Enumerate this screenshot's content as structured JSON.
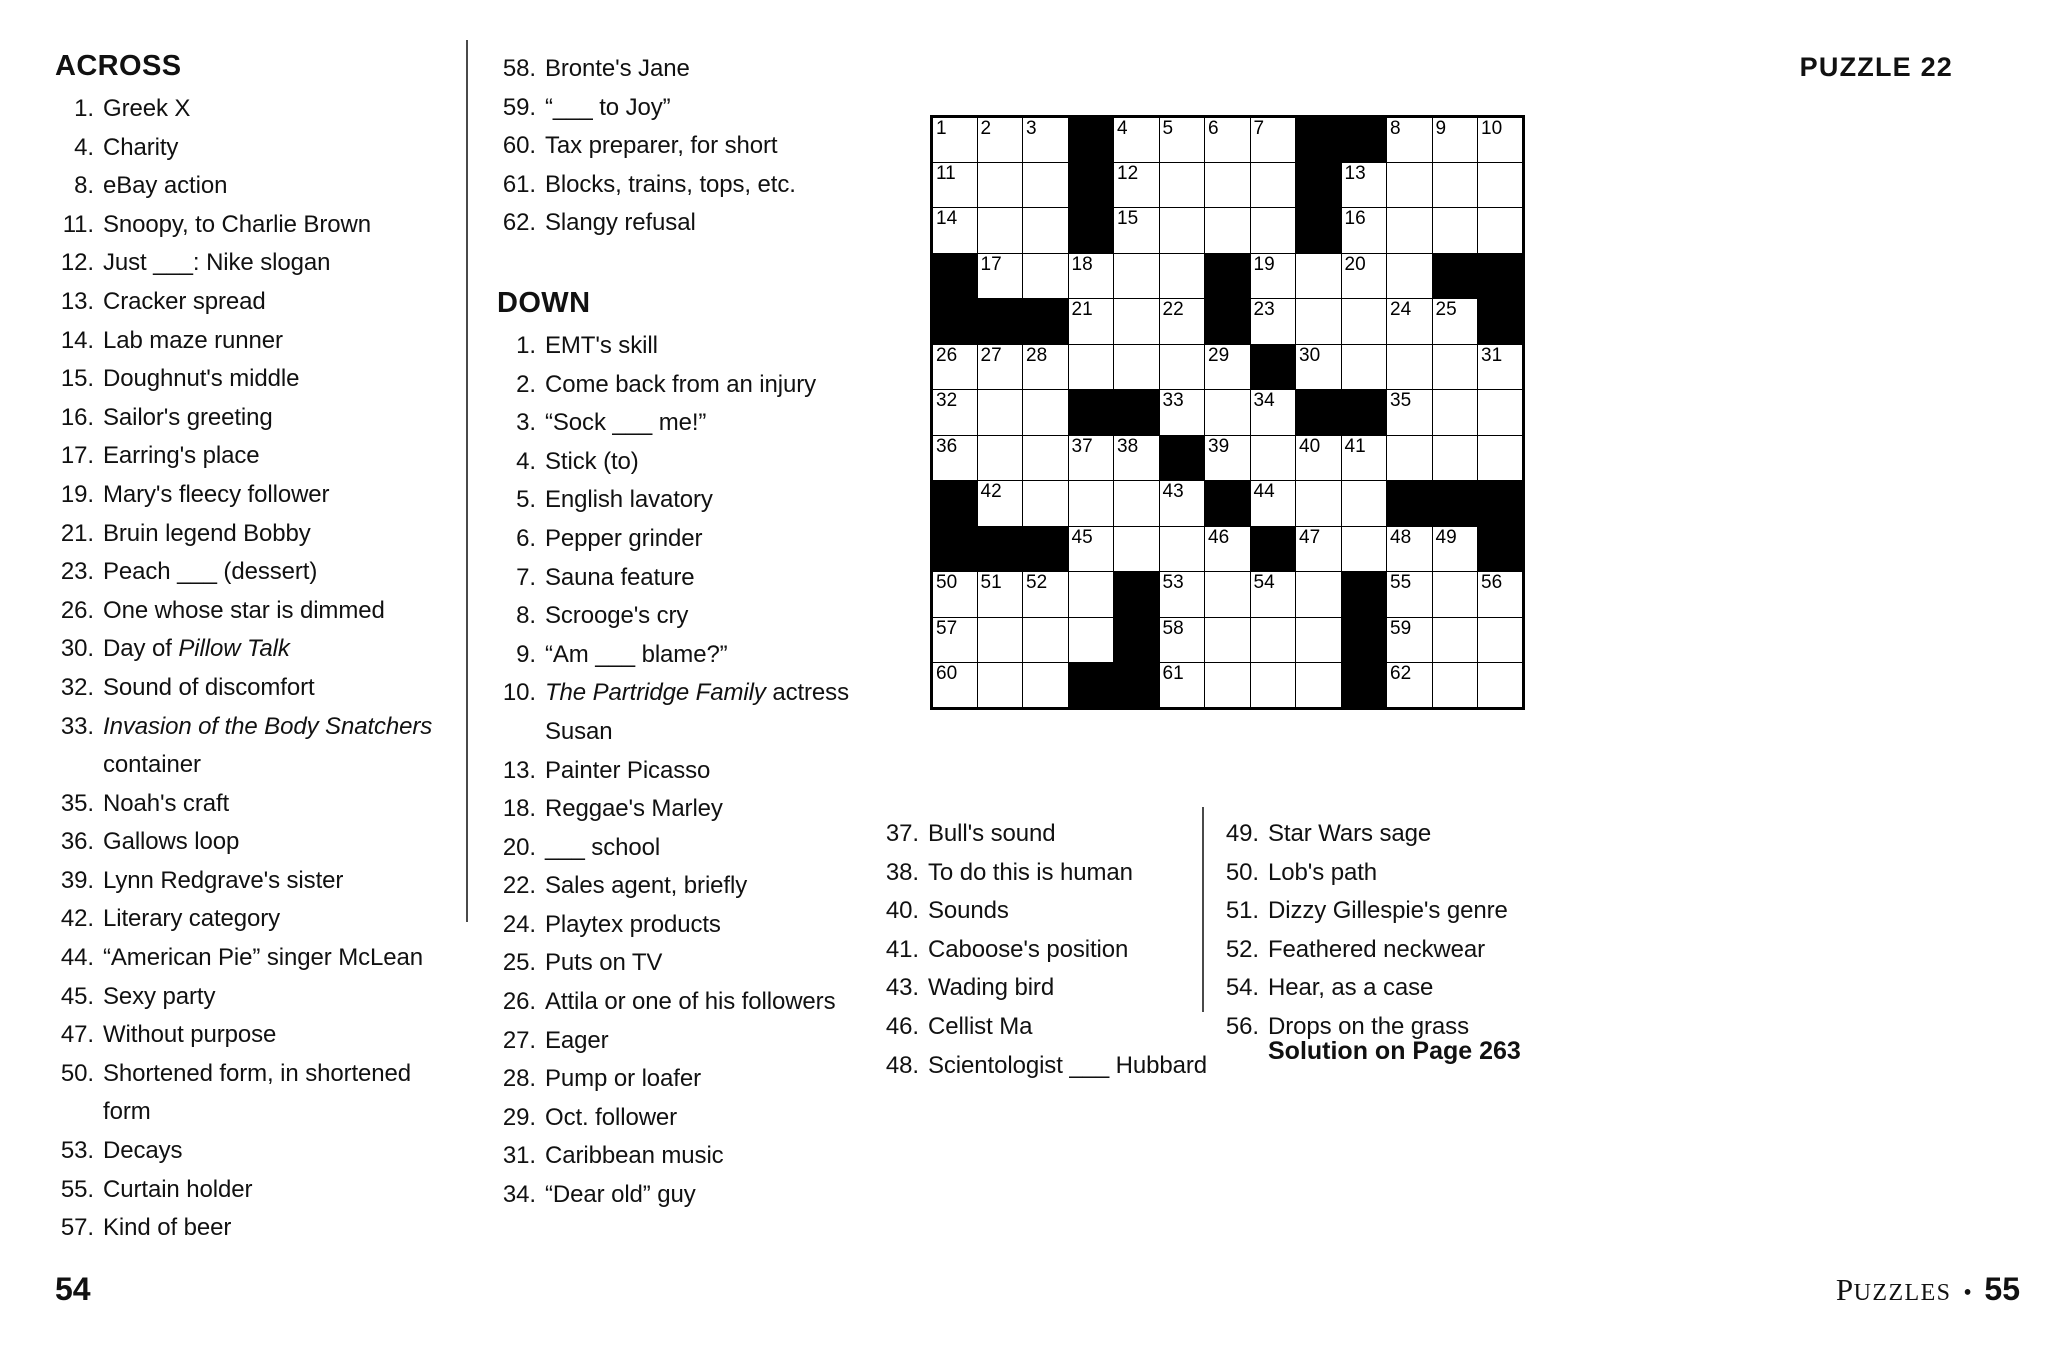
{
  "left_page": {
    "folio": "54",
    "column1": {
      "across_heading": "ACROSS",
      "across_clues": [
        {
          "num": "1.",
          "text": "Greek X"
        },
        {
          "num": "4.",
          "text": "Charity"
        },
        {
          "num": "8.",
          "text": "eBay action"
        },
        {
          "num": "11.",
          "text": "Snoopy, to Charlie Brown"
        },
        {
          "num": "12.",
          "text": "Just ___: Nike slogan"
        },
        {
          "num": "13.",
          "text": "Cracker spread"
        },
        {
          "num": "14.",
          "text": "Lab maze runner"
        },
        {
          "num": "15.",
          "text": "Doughnut's middle"
        },
        {
          "num": "16.",
          "text": "Sailor's greeting"
        },
        {
          "num": "17.",
          "text": "Earring's place"
        },
        {
          "num": "19.",
          "text": "Mary's fleecy follower"
        },
        {
          "num": "21.",
          "text": "Bruin legend Bobby"
        },
        {
          "num": "23.",
          "text": "Peach ___ (dessert)"
        },
        {
          "num": "26.",
          "text": "One whose star is dimmed"
        },
        {
          "num": "30.",
          "text": "Day of ",
          "italic": "Pillow Talk",
          "after": ""
        },
        {
          "num": "32.",
          "text": "Sound of discomfort"
        },
        {
          "num": "33.",
          "text": "",
          "italic": "Invasion of the Body Snatchers",
          "after": " container"
        },
        {
          "num": "35.",
          "text": "Noah's craft"
        },
        {
          "num": "36.",
          "text": "Gallows loop"
        },
        {
          "num": "39.",
          "text": "Lynn Redgrave's sister"
        },
        {
          "num": "42.",
          "text": "Literary category"
        },
        {
          "num": "44.",
          "text": "“American Pie” singer McLean"
        },
        {
          "num": "45.",
          "text": "Sexy party"
        },
        {
          "num": "47.",
          "text": "Without purpose"
        },
        {
          "num": "50.",
          "text": "Shortened form, in shortened form"
        },
        {
          "num": "53.",
          "text": "Decays"
        },
        {
          "num": "55.",
          "text": "Curtain holder"
        },
        {
          "num": "57.",
          "text": "Kind of beer"
        }
      ]
    },
    "column2": {
      "across_continued": [
        {
          "num": "58.",
          "text": "Bronte's Jane"
        },
        {
          "num": "59.",
          "text": "“___ to Joy”"
        },
        {
          "num": "60.",
          "text": "Tax preparer, for short"
        },
        {
          "num": "61.",
          "text": "Blocks, trains, tops, etc."
        },
        {
          "num": "62.",
          "text": "Slangy refusal"
        }
      ],
      "down_heading": "DOWN",
      "down_clues": [
        {
          "num": "1.",
          "text": "EMT's skill"
        },
        {
          "num": "2.",
          "text": "Come back from an injury"
        },
        {
          "num": "3.",
          "text": "“Sock ___ me!”"
        },
        {
          "num": "4.",
          "text": "Stick (to)"
        },
        {
          "num": "5.",
          "text": "English lavatory"
        },
        {
          "num": "6.",
          "text": "Pepper grinder"
        },
        {
          "num": "7.",
          "text": "Sauna feature"
        },
        {
          "num": "8.",
          "text": "Scrooge's cry"
        },
        {
          "num": "9.",
          "text": "“Am ___ blame?”"
        },
        {
          "num": "10.",
          "text": "",
          "italic": "The Partridge Family",
          "after": " actress Susan"
        },
        {
          "num": "13.",
          "text": "Painter Picasso"
        },
        {
          "num": "18.",
          "text": "Reggae's Marley"
        },
        {
          "num": "20.",
          "text": "___ school"
        },
        {
          "num": "22.",
          "text": "Sales agent, briefly"
        },
        {
          "num": "24.",
          "text": "Playtex products"
        },
        {
          "num": "25.",
          "text": "Puts on TV"
        },
        {
          "num": "26.",
          "text": "Attila or one of his followers"
        },
        {
          "num": "27.",
          "text": "Eager"
        },
        {
          "num": "28.",
          "text": "Pump or loafer"
        },
        {
          "num": "29.",
          "text": "Oct. follower"
        },
        {
          "num": "31.",
          "text": "Caribbean music"
        },
        {
          "num": "34.",
          "text": "“Dear old” guy"
        }
      ]
    }
  },
  "right_page": {
    "puzzle_title": "PUZZLE 22",
    "folio_word_p": "P",
    "folio_word_rest": "UZZLES",
    "folio_dot": "•",
    "folio_number": "55",
    "solution_note": "Solution on Page 263",
    "bottom_column_a": [
      {
        "num": "37.",
        "text": "Bull's sound"
      },
      {
        "num": "38.",
        "text": "To do this is human"
      },
      {
        "num": "40.",
        "text": "Sounds"
      },
      {
        "num": "41.",
        "text": "Caboose's position"
      },
      {
        "num": "43.",
        "text": "Wading bird"
      },
      {
        "num": "46.",
        "text": "Cellist Ma"
      },
      {
        "num": "48.",
        "text": "Scientologist ___ Hubbard"
      }
    ],
    "bottom_column_b": [
      {
        "num": "49.",
        "text": "Star Wars sage"
      },
      {
        "num": "50.",
        "text": "Lob's path"
      },
      {
        "num": "51.",
        "text": "Dizzy Gillespie's genre"
      },
      {
        "num": "52.",
        "text": "Feathered neckwear"
      },
      {
        "num": "54.",
        "text": "Hear, as a case"
      },
      {
        "num": "56.",
        "text": "Drops on the grass"
      }
    ],
    "grid": {
      "rows": 13,
      "cols": 13,
      "cells": [
        [
          {
            "n": "1"
          },
          {
            "n": "2"
          },
          {
            "n": "3"
          },
          {
            "b": 1
          },
          {
            "n": "4"
          },
          {
            "n": "5"
          },
          {
            "n": "6"
          },
          {
            "n": "7"
          },
          {
            "b": 1
          },
          {
            "b": 1
          },
          {
            "n": "8"
          },
          {
            "n": "9"
          },
          {
            "n": "10"
          }
        ],
        [
          {
            "n": "11"
          },
          {},
          {},
          {
            "b": 1
          },
          {
            "n": "12"
          },
          {},
          {},
          {},
          {
            "b": 1
          },
          {
            "n": "13"
          },
          {},
          {},
          {}
        ],
        [
          {
            "n": "14"
          },
          {},
          {},
          {
            "b": 1
          },
          {
            "n": "15"
          },
          {},
          {},
          {},
          {
            "b": 1
          },
          {
            "n": "16"
          },
          {},
          {},
          {}
        ],
        [
          {
            "b": 1
          },
          {
            "n": "17"
          },
          {},
          {
            "n": "18"
          },
          {},
          {},
          {
            "b": 1
          },
          {
            "n": "19"
          },
          {},
          {
            "n": "20"
          },
          {},
          {
            "b": 1
          },
          {
            "b": 1
          }
        ],
        [
          {
            "b": 1
          },
          {
            "b": 1
          },
          {
            "b": 1
          },
          {
            "n": "21"
          },
          {},
          {
            "n": "22"
          },
          {
            "b": 1
          },
          {
            "n": "23"
          },
          {},
          {},
          {
            "n": "24"
          },
          {
            "n": "25"
          },
          {
            "b": 1
          }
        ],
        [
          {
            "n": "26"
          },
          {
            "n": "27"
          },
          {
            "n": "28"
          },
          {},
          {},
          {},
          {
            "n": "29"
          },
          {
            "b": 1
          },
          {
            "n": "30"
          },
          {},
          {},
          {},
          {
            "n": "31"
          }
        ],
        [
          {
            "n": "32"
          },
          {},
          {},
          {
            "b": 1
          },
          {
            "b": 1
          },
          {
            "n": "33"
          },
          {},
          {
            "n": "34"
          },
          {
            "b": 1
          },
          {
            "b": 1
          },
          {
            "n": "35"
          },
          {},
          {}
        ],
        [
          {
            "n": "36"
          },
          {},
          {},
          {
            "n": "37"
          },
          {
            "n": "38"
          },
          {
            "b": 1
          },
          {
            "n": "39"
          },
          {},
          {
            "n": "40"
          },
          {
            "n": "41"
          },
          {},
          {},
          {}
        ],
        [
          {
            "b": 1
          },
          {
            "n": "42"
          },
          {},
          {},
          {},
          {
            "n": "43"
          },
          {
            "b": 1
          },
          {
            "n": "44"
          },
          {},
          {},
          {
            "b": 1
          },
          {
            "b": 1
          },
          {
            "b": 1
          }
        ],
        [
          {
            "b": 1
          },
          {
            "b": 1
          },
          {
            "b": 1
          },
          {
            "n": "45"
          },
          {},
          {},
          {
            "n": "46"
          },
          {
            "b": 1
          },
          {
            "n": "47"
          },
          {},
          {
            "n": "48"
          },
          {
            "n": "49"
          },
          {
            "b": 1
          }
        ],
        [
          {
            "n": "50"
          },
          {
            "n": "51"
          },
          {
            "n": "52"
          },
          {},
          {
            "b": 1
          },
          {
            "n": "53"
          },
          {},
          {
            "n": "54"
          },
          {},
          {
            "b": 1
          },
          {
            "n": "55"
          },
          {},
          {
            "n": "56"
          }
        ],
        [
          {
            "n": "57"
          },
          {},
          {},
          {},
          {
            "b": 1
          },
          {
            "n": "58"
          },
          {},
          {},
          {},
          {
            "b": 1
          },
          {
            "n": "59"
          },
          {},
          {}
        ],
        [
          {
            "n": "60"
          },
          {},
          {},
          {
            "b": 1
          },
          {
            "b": 1
          },
          {
            "n": "61"
          },
          {},
          {},
          {},
          {
            "b": 1
          },
          {
            "n": "62"
          },
          {},
          {}
        ]
      ]
    }
  }
}
